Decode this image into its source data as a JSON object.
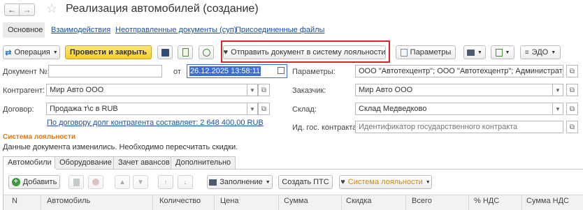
{
  "window": {
    "title": "Реализация автомобилей (создание)"
  },
  "nav_tabs": [
    {
      "label": "Основное"
    },
    {
      "label": "Взаимодействия"
    },
    {
      "label": "Неотправленные документы (суп)"
    },
    {
      "label": "Присоединенные файлы"
    }
  ],
  "toolbar": {
    "operation_label": "Операция",
    "post_close_label": "Провести и закрыть",
    "send_loyalty_label": "Отправить документ в систему лояльности",
    "params_label": "Параметры",
    "edo_label": "ЭДО"
  },
  "form": {
    "doc_number_label": "Документ №:",
    "doc_number_value": "",
    "from_label": "от",
    "date_value": "26.12.2025 13:58:11",
    "params_label": "Параметры:",
    "params_value": "ООО \"Автотехцентр\"; ООО \"Автотехцентр\"; Администратор",
    "contractor_label": "Контрагент:",
    "contractor_value": "Мир Авто ООО",
    "customer_label": "Заказчик:",
    "customer_value": "Мир Авто ООО",
    "contract_label": "Договор:",
    "contract_value": "Продажа т\\с в RUB",
    "warehouse_label": "Склад:",
    "warehouse_value": "Склад Медведково",
    "debt_link": "По договору долг контрагента составляет: 2 648 400,00 RUB",
    "gov_contract_label": "Ид. гос. контракта:",
    "gov_contract_placeholder": "Идентификатор государственного контракта"
  },
  "loyalty": {
    "section_title": "Система лояльности",
    "message": "Данные документа изменились. Необходимо пересчитать скидки."
  },
  "table_tabs": [
    {
      "label": "Автомобили"
    },
    {
      "label": "Оборудование"
    },
    {
      "label": "Зачет авансов"
    },
    {
      "label": "Дополнительно"
    }
  ],
  "table_toolbar": {
    "add_label": "Добавить",
    "fill_label": "Заполнение",
    "create_pts_label": "Создать ПТС",
    "loyalty_label": "Система лояльности"
  },
  "table": {
    "columns": [
      "N",
      "Автомобиль",
      "Количество",
      "Цена",
      "Сумма",
      "Скидка",
      "Всего",
      "% НДС",
      "Сумма НДС"
    ]
  },
  "colors": {
    "accent_orange": "#d97a16",
    "highlight_red": "#d9252c",
    "link_blue": "#1a4f9c",
    "date_selection": "#3b6fd4"
  }
}
